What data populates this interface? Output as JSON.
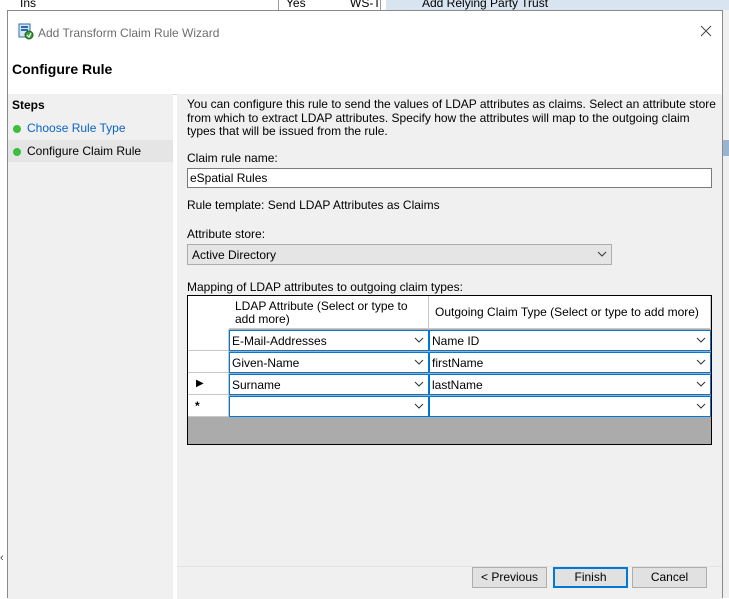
{
  "background": {
    "fragments": [
      "Ins",
      "Yes",
      "WS-T",
      "Add Relying Party Trust"
    ]
  },
  "dialog": {
    "title": "Add Transform Claim Rule Wizard",
    "header": "Configure Rule"
  },
  "steps": {
    "heading": "Steps",
    "items": [
      {
        "label": "Choose Rule Type",
        "state": "completed"
      },
      {
        "label": "Configure Claim Rule",
        "state": "current"
      }
    ]
  },
  "main": {
    "description": "You can configure this rule to send the values of LDAP attributes as claims. Select an attribute store from which to extract LDAP attributes. Specify how the attributes will map to the outgoing claim types that will be issued from the rule.",
    "claim_rule_name_label": "Claim rule name:",
    "claim_rule_name_value": "eSpatial Rules",
    "rule_template": "Rule template: Send LDAP Attributes as Claims",
    "attribute_store_label": "Attribute store:",
    "attribute_store_value": "Active Directory",
    "mapping_label": "Mapping of LDAP attributes to outgoing claim types:",
    "grid": {
      "columns": [
        "LDAP Attribute (Select or type to add more)",
        "Outgoing Claim Type (Select or type to add more)"
      ],
      "rows": [
        {
          "ldap": "E-Mail-Addresses",
          "claim": "Name ID",
          "marker": ""
        },
        {
          "ldap": "Given-Name",
          "claim": "firstName",
          "marker": ""
        },
        {
          "ldap": "Surname",
          "claim": "lastName",
          "marker": "current-row"
        },
        {
          "ldap": "",
          "claim": "",
          "marker": "new-row"
        }
      ]
    }
  },
  "footer": {
    "previous": "< Previous",
    "finish": "Finish",
    "cancel": "Cancel"
  },
  "colors": {
    "accent": "#0078d7",
    "link": "#0b63c5",
    "step_done": "#3cbf3c",
    "panel": "#f0f0f0"
  }
}
